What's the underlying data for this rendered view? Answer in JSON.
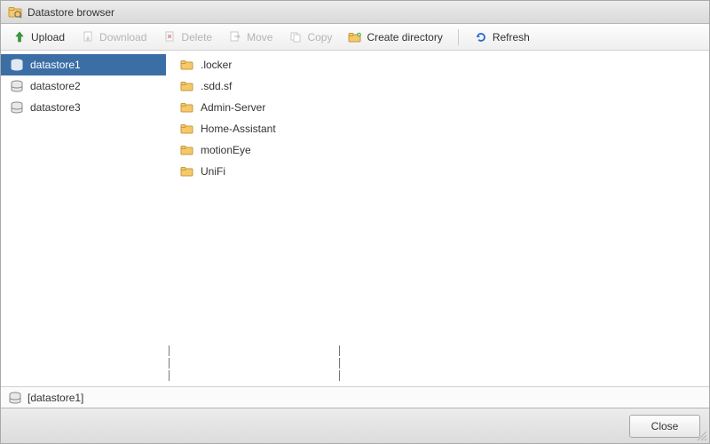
{
  "window": {
    "title": "Datastore browser"
  },
  "toolbar": {
    "upload": "Upload",
    "download": "Download",
    "delete": "Delete",
    "move": "Move",
    "copy": "Copy",
    "create_dir": "Create directory",
    "refresh": "Refresh"
  },
  "datastores": {
    "items": [
      {
        "name": "datastore1",
        "selected": true
      },
      {
        "name": "datastore2",
        "selected": false
      },
      {
        "name": "datastore3",
        "selected": false
      }
    ]
  },
  "folders": {
    "items": [
      {
        "name": ".locker"
      },
      {
        "name": ".sdd.sf"
      },
      {
        "name": "Admin-Server"
      },
      {
        "name": "Home-Assistant"
      },
      {
        "name": "motionEye"
      },
      {
        "name": "UniFi"
      }
    ]
  },
  "path": {
    "text": "[datastore1]"
  },
  "footer": {
    "close": "Close"
  }
}
